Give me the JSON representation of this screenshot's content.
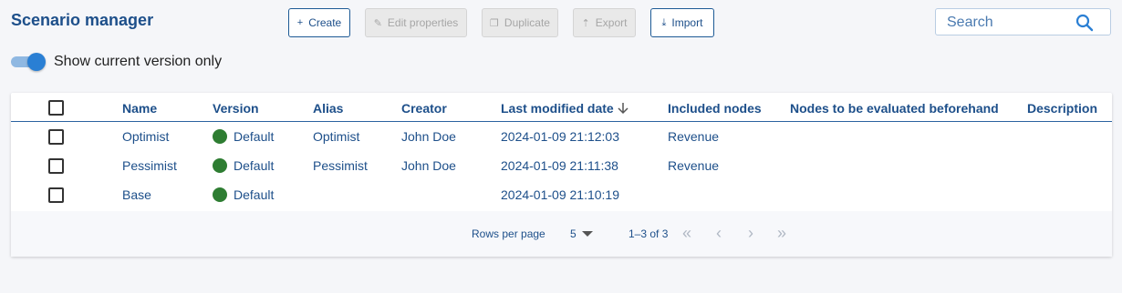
{
  "header": {
    "title": "Scenario manager",
    "buttons": {
      "create": "Create",
      "edit": "Edit properties",
      "duplicate": "Duplicate",
      "export": "Export",
      "import": "Import"
    },
    "search_placeholder": "Search"
  },
  "toggle": {
    "label": "Show current version only",
    "on": true
  },
  "table": {
    "columns": {
      "name": "Name",
      "version": "Version",
      "alias": "Alias",
      "creator": "Creator",
      "modified": "Last modified date",
      "nodes": "Included nodes",
      "evaluated": "Nodes to be evaluated beforehand",
      "description": "Description"
    },
    "sort_icon": "arrow-down-icon",
    "rows": [
      {
        "name": "Optimist",
        "version": "Default",
        "alias": "Optimist",
        "creator": "John Doe",
        "modified": "2024-01-09 21:12:03",
        "nodes": "Revenue"
      },
      {
        "name": "Pessimist",
        "version": "Default",
        "alias": "Pessimist",
        "creator": "John Doe",
        "modified": "2024-01-09 21:11:38",
        "nodes": "Revenue"
      },
      {
        "name": "Base",
        "version": "Default",
        "alias": "",
        "creator": "",
        "modified": "2024-01-09 21:10:19",
        "nodes": ""
      }
    ]
  },
  "pagination": {
    "rows_per_page_label": "Rows per page",
    "rows_per_page": "5",
    "range": "1–3 of 3"
  },
  "colors": {
    "accent": "#1d4f8a",
    "version_dot": "#2e7d32",
    "toggle": "#2a7fd4"
  }
}
